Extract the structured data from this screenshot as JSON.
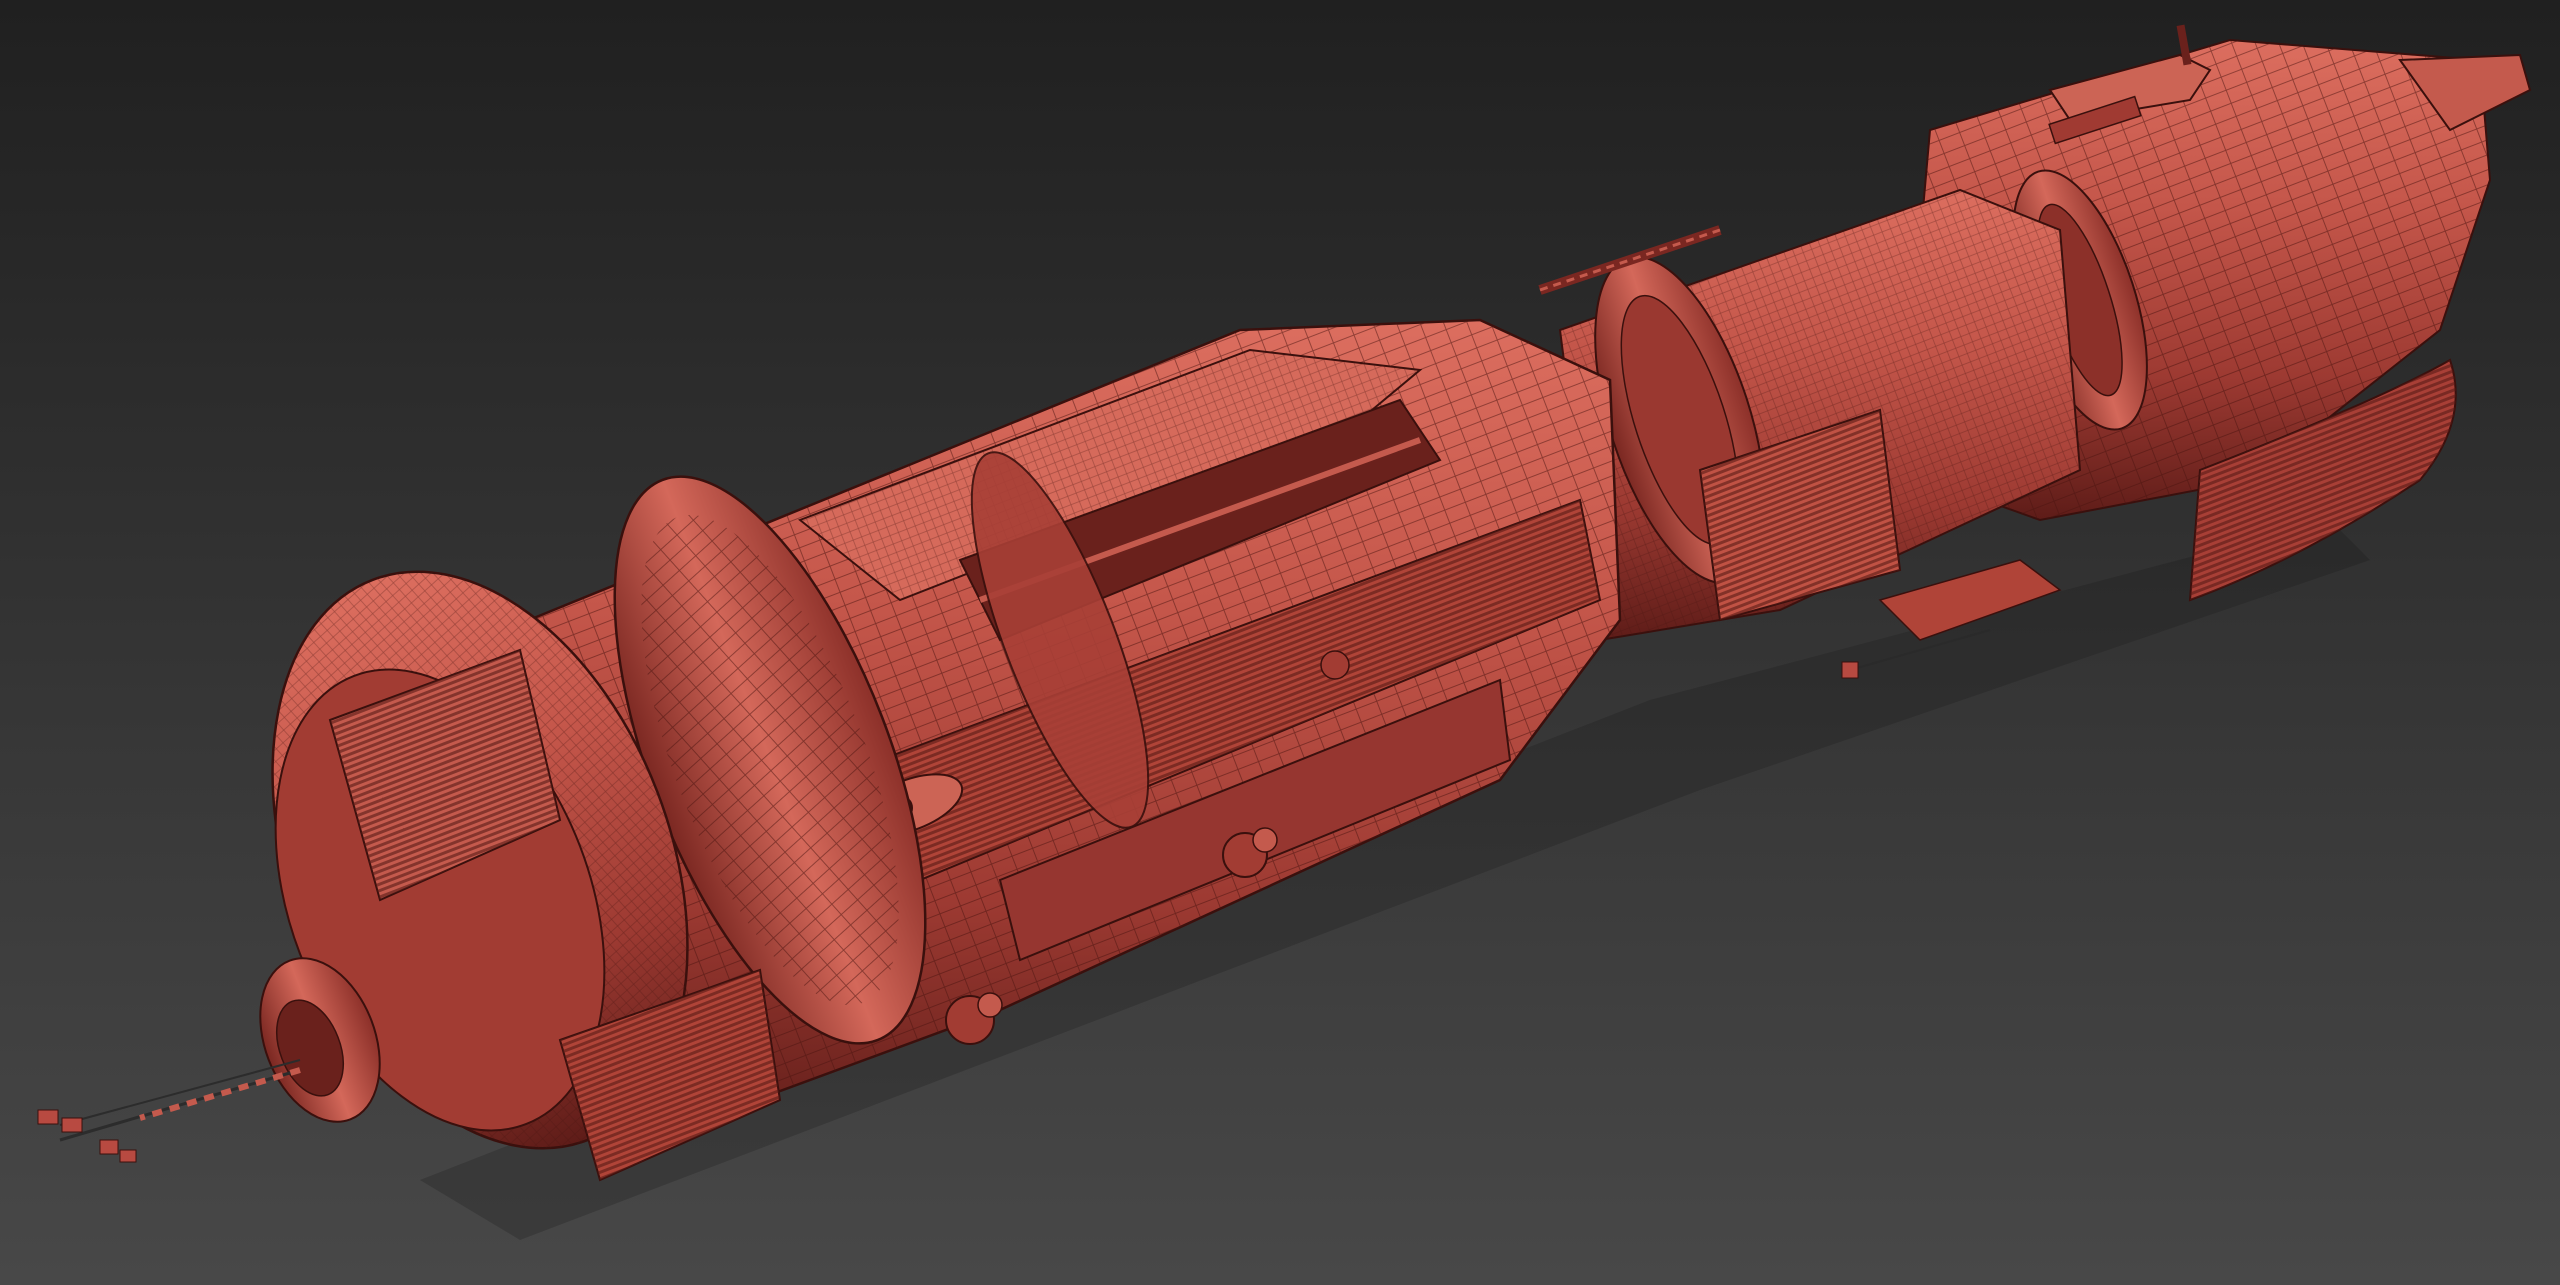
{
  "scene": {
    "subject": "spaceship-3d-model",
    "background": {
      "top": "#202020",
      "bottom": "#484848"
    },
    "colors": {
      "hull_base": "#b84a41",
      "hull_light": "#dc6e5f",
      "hull_dark": "#6a211c",
      "hull_mid": "#a03a32",
      "wire": "#3a100d"
    }
  }
}
